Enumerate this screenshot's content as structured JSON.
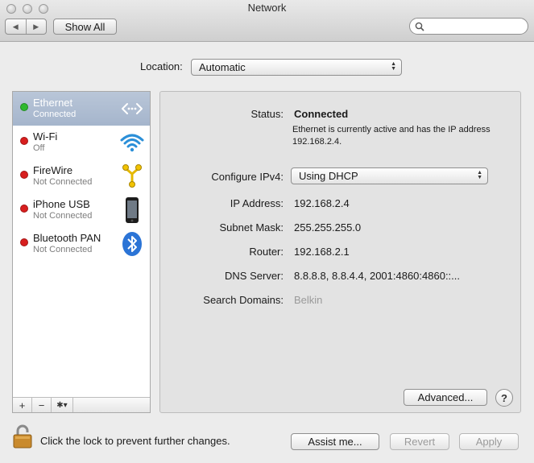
{
  "window": {
    "title": "Network",
    "show_all_label": "Show All",
    "nav_back_icon": "◀",
    "nav_forward_icon": "▶",
    "search_placeholder": ""
  },
  "location": {
    "label": "Location:",
    "value": "Automatic"
  },
  "services": [
    {
      "name": "Ethernet",
      "status": "Connected",
      "status_color": "#2fb92f",
      "icon": "ethernet-icon",
      "selected": true
    },
    {
      "name": "Wi-Fi",
      "status": "Off",
      "status_color": "#d81e1e",
      "icon": "wifi-icon",
      "selected": false
    },
    {
      "name": "FireWire",
      "status": "Not Connected",
      "status_color": "#d81e1e",
      "icon": "firewire-icon",
      "selected": false
    },
    {
      "name": "iPhone USB",
      "status": "Not Connected",
      "status_color": "#d81e1e",
      "icon": "iphone-icon",
      "selected": false
    },
    {
      "name": "Bluetooth PAN",
      "status": "Not Connected",
      "status_color": "#d81e1e",
      "icon": "bluetooth-icon",
      "selected": false
    }
  ],
  "list_footer": {
    "add": "+",
    "remove": "−",
    "gear": "✱▾"
  },
  "detail": {
    "status_label": "Status:",
    "status_value": "Connected",
    "status_description": "Ethernet is currently active and has the IP address 192.168.2.4.",
    "configure_label": "Configure IPv4:",
    "configure_value": "Using DHCP",
    "ip_label": "IP Address:",
    "ip_value": "192.168.2.4",
    "subnet_label": "Subnet Mask:",
    "subnet_value": "255.255.255.0",
    "router_label": "Router:",
    "router_value": "192.168.2.1",
    "dns_label": "DNS Server:",
    "dns_value": "8.8.8.8, 8.8.4.4, 2001:4860:4860::...",
    "search_domains_label": "Search Domains:",
    "search_domains_value": "Belkin",
    "advanced_label": "Advanced...",
    "help_label": "?"
  },
  "footer": {
    "lock_text": "Click the lock to prevent further changes.",
    "assist_label": "Assist me...",
    "revert_label": "Revert",
    "apply_label": "Apply"
  },
  "colors": {
    "selection": "#a9b8cd",
    "connected": "#2fb92f",
    "disconnected": "#d81e1e"
  }
}
